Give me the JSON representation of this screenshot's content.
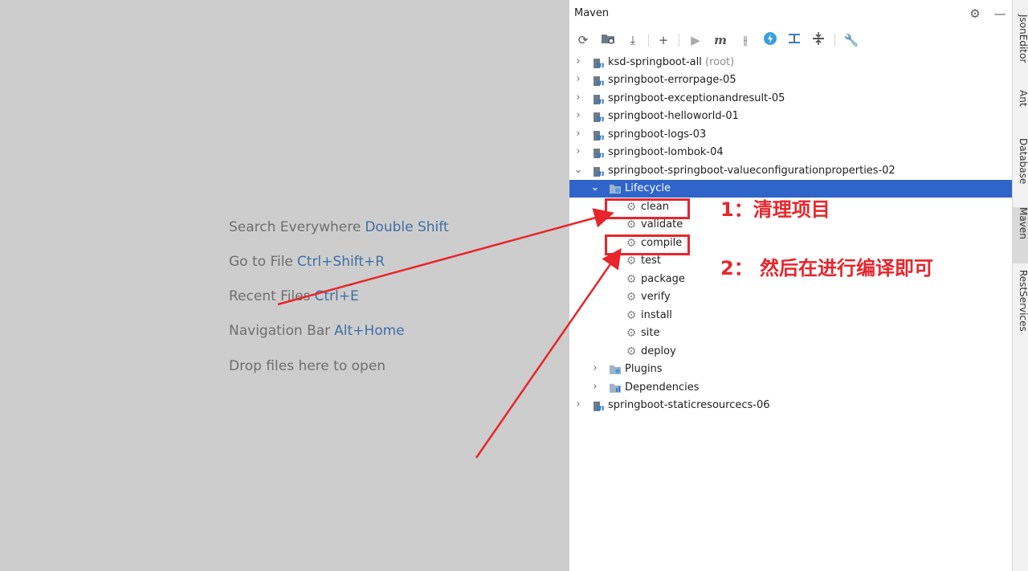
{
  "welcome": {
    "hints": [
      {
        "text": "Search Everywhere",
        "key": "Double Shift"
      },
      {
        "text": "Go to File",
        "key": "Ctrl+Shift+R"
      },
      {
        "text": "Recent Files",
        "key": "Ctrl+E"
      },
      {
        "text": "Navigation Bar",
        "key": "Alt+Home"
      },
      {
        "text": "Drop files here to open",
        "key": ""
      }
    ]
  },
  "maven": {
    "title": "Maven",
    "toolbar_icons": [
      "refresh-icon",
      "generate-sources-icon",
      "download-icon",
      "add-icon",
      "run-icon",
      "maven-goal-icon",
      "toggle-offline-icon",
      "skip-tests-icon",
      "show-dependencies-icon",
      "collapse-all-icon",
      "settings-wrench-icon"
    ],
    "projects": [
      {
        "name": "ksd-springboot-all",
        "suffix": "(root)"
      },
      {
        "name": "springboot-errorpage-05"
      },
      {
        "name": "springboot-exceptionandresult-05"
      },
      {
        "name": "springboot-helloworld-01"
      },
      {
        "name": "springboot-logs-03"
      },
      {
        "name": "springboot-lombok-04"
      },
      {
        "name": "springboot-springboot-valueconfigurationproperties-02"
      },
      {
        "name": "springboot-staticresourcecs-06"
      }
    ],
    "lifecycle_label": "Lifecycle",
    "lifecycle_goals": [
      "clean",
      "validate",
      "compile",
      "test",
      "package",
      "verify",
      "install",
      "site",
      "deploy"
    ],
    "plugins_label": "Plugins",
    "dependencies_label": "Dependencies"
  },
  "side_tools": [
    "JsonEditor",
    "Ant",
    "Database",
    "Maven",
    "RestServices"
  ],
  "annotations": {
    "step1": "1：清理项目",
    "step2": "2：  然后在进行编译即可"
  },
  "colors": {
    "selection": "#2f65ca",
    "annotation": "#e8252b",
    "editor_bg": "#cdcdcd",
    "key_blue": "#3f6fa4"
  }
}
